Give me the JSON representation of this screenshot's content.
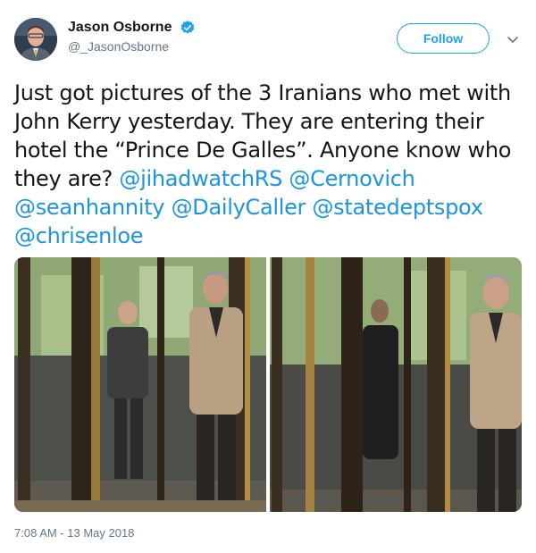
{
  "user": {
    "display_name": "Jason Osborne",
    "handle": "@_JasonOsborne",
    "verified": true
  },
  "follow_label": "Follow",
  "tweet": {
    "text_parts": [
      "Just got pictures of the 3 Iranians who met with John Kerry yesterday.  They are entering their hotel the “Prince De Galles”. Anyone know who they are? ",
      "@jihadwatchRS",
      " ",
      "@Cernovich",
      " ",
      "@seanhannity",
      " ",
      "@DailyCaller",
      " ",
      "@statedeptspox",
      " ",
      "@chrisenloe"
    ]
  },
  "timestamp": "7:08 AM - 13 May 2018",
  "colors": {
    "accent": "#1da1f2",
    "link": "#1b95e0",
    "muted": "#657786",
    "text": "#14171a"
  },
  "icons": {
    "verified": "verified-badge-icon",
    "caret": "chevron-down-icon"
  }
}
